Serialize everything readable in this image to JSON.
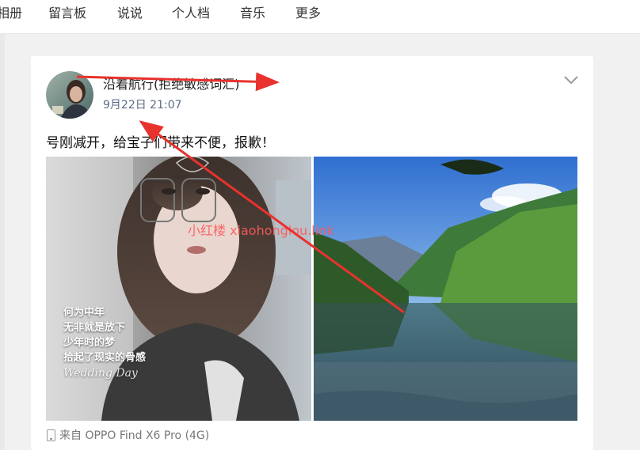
{
  "nav": {
    "items": [
      {
        "label": "相册"
      },
      {
        "label": "留言板"
      },
      {
        "label": "说说"
      },
      {
        "label": "个人档"
      },
      {
        "label": "音乐"
      },
      {
        "label": "更多"
      }
    ]
  },
  "post": {
    "nickname": "沿着航行(拒绝敏感词汇)",
    "timestamp": "9月22日 21:07",
    "text": "号刚减开，给宝子们带来不便，报歉！",
    "image_left_caption": [
      "何为中年",
      "无非就是放下",
      "少年时的梦",
      "拾起了现实的骨感"
    ],
    "image_left_script": "Wedding Day",
    "watermark": "小红楼 xiaohonglou.link",
    "device": "来自 OPPO Find X6 Pro (4G)"
  },
  "colors": {
    "accent_red": "#e8322e",
    "timestamp_blue": "#5a6a86"
  }
}
